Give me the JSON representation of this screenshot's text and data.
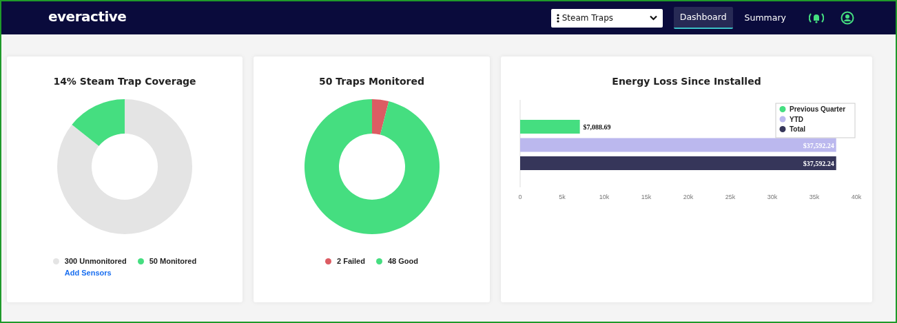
{
  "navbar": {
    "logo": "everactive",
    "selector": {
      "value": "Steam Traps"
    },
    "links": [
      {
        "label": "Dashboard",
        "selected": true
      },
      {
        "label": "Summary",
        "selected": false
      }
    ]
  },
  "cards": [
    {
      "title": "14% Steam Trap Coverage",
      "link": "Add Sensors",
      "chart_data": {
        "type": "donut",
        "categories": [
          "300 Unmonitored",
          "50 Monitored"
        ],
        "values": [
          300,
          50
        ],
        "colors": [
          "#e4e4e4",
          "#45de80"
        ]
      }
    },
    {
      "title": "50 Traps Monitored",
      "chart_data": {
        "type": "donut",
        "categories": [
          "2 Failed",
          "48 Good"
        ],
        "values": [
          2,
          48
        ],
        "colors": [
          "#dc5c63",
          "#45de80"
        ]
      }
    },
    {
      "title": "Energy Loss Since Installed",
      "chart_data": {
        "type": "bar",
        "orientation": "horizontal",
        "legend": true,
        "xlim": [
          0,
          40000
        ],
        "xticks": [
          {
            "value": 0,
            "label": "0"
          },
          {
            "value": 5000,
            "label": "5k"
          },
          {
            "value": 10000,
            "label": "10k"
          },
          {
            "value": 15000,
            "label": "15k"
          },
          {
            "value": 20000,
            "label": "20k"
          },
          {
            "value": 25000,
            "label": "25k"
          },
          {
            "value": 30000,
            "label": "30k"
          },
          {
            "value": 35000,
            "label": "35k"
          },
          {
            "value": 40000,
            "label": "40k"
          }
        ],
        "series": [
          {
            "name": "Previous Quarter",
            "color": "#45de80",
            "values": [
              7100
            ]
          },
          {
            "name": "YTD",
            "color": "#bbb8ee",
            "values": [
              37600
            ]
          },
          {
            "name": "Total",
            "color": "#36365a",
            "values": [
              37600
            ]
          }
        ],
        "value_labels": [
          "$7,088.69",
          "$37,592.24",
          "$37,592.24"
        ]
      }
    }
  ]
}
